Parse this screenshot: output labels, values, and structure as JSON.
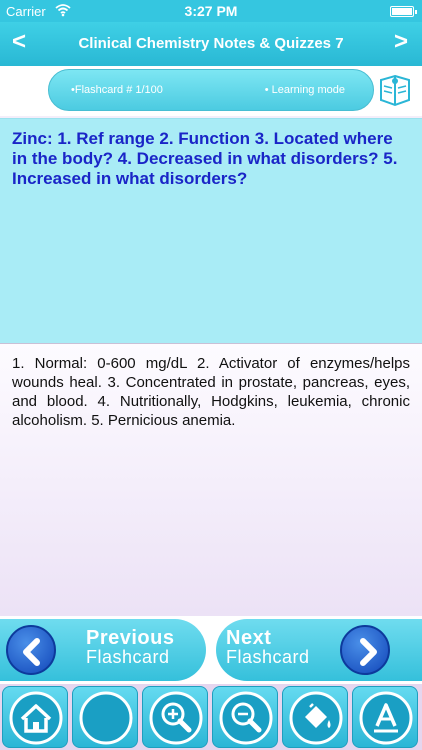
{
  "status_bar": {
    "carrier": "Carrier",
    "time": "3:27 PM"
  },
  "nav_bar": {
    "back": "<",
    "title": "Clinical Chemistry Notes & Quizzes 7",
    "forward": ">"
  },
  "info": {
    "flashcard": "•Flashcard #  1/100",
    "mode": "• Learning mode"
  },
  "card": {
    "question": "Zinc:  1. Ref range 2. Function 3. Located where in the body? 4. Decreased in what disorders? 5. Increased in what disorders?",
    "answer": "1. Normal: 0-600 mg/dL 2. Activator of enzymes/helps wounds heal. 3. Concentrated in prostate, pancreas, eyes, and blood. 4. Nutritionally, Hodgkins, leukemia, chronic alcoholism.  5. Pernicious anemia."
  },
  "navigation": {
    "previous": {
      "line1": "Previous",
      "line2": "Flashcard"
    },
    "next": {
      "line1": "Next",
      "line2": "Flashcard"
    }
  },
  "toolbar": {
    "icons": [
      "home-icon",
      "blank-circle-icon",
      "zoom-in-icon",
      "zoom-out-icon",
      "paint-bucket-icon",
      "font-icon"
    ]
  },
  "colors": {
    "accent": "#35c6e0",
    "question_text": "#1a25c7",
    "question_bg": "#a9ecf6",
    "arrow_blue": "#1146b9"
  }
}
